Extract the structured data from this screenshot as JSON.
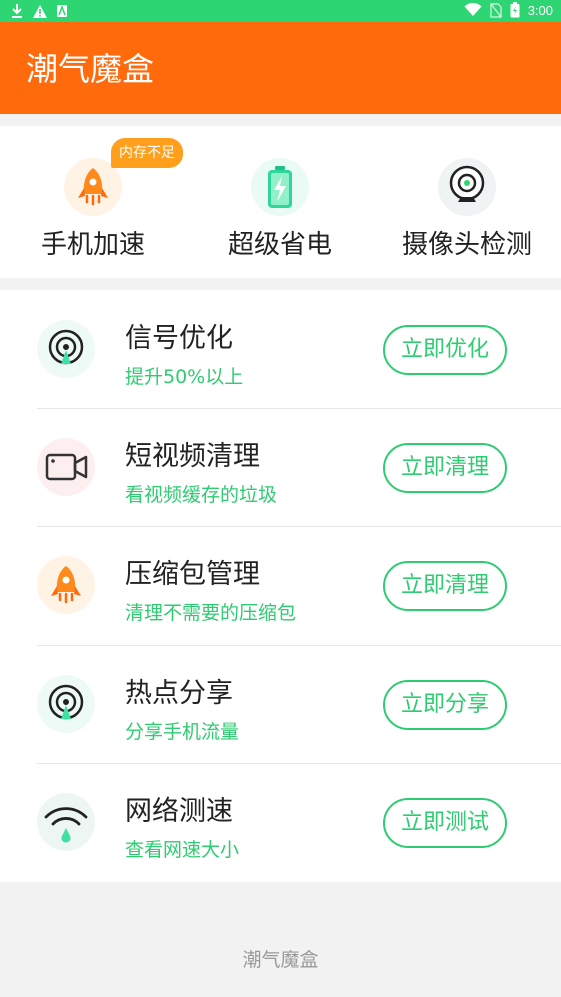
{
  "status_bar": {
    "time": "3:00"
  },
  "app_bar": {
    "title": "潮气魔盒"
  },
  "quick_actions": {
    "badge": "内存不足",
    "items": [
      {
        "label": "手机加速",
        "icon": "rocket-icon"
      },
      {
        "label": "超级省电",
        "icon": "battery-icon"
      },
      {
        "label": "摄像头检测",
        "icon": "camera-icon"
      }
    ]
  },
  "list": [
    {
      "title": "信号优化",
      "subtitle": "提升50%以上",
      "button": "立即优化",
      "icon": "signal-icon"
    },
    {
      "title": "短视频清理",
      "subtitle": "看视频缓存的垃圾",
      "button": "立即清理",
      "icon": "video-icon"
    },
    {
      "title": "压缩包管理",
      "subtitle": "清理不需要的压缩包",
      "button": "立即清理",
      "icon": "rocket-icon"
    },
    {
      "title": "热点分享",
      "subtitle": "分享手机流量",
      "button": "立即分享",
      "icon": "hotspot-icon"
    },
    {
      "title": "网络测速",
      "subtitle": "查看网速大小",
      "button": "立即测试",
      "icon": "wifi-icon"
    }
  ],
  "footer": {
    "text": "潮气魔盒"
  },
  "colors": {
    "status": "#2ed573",
    "header": "#ff6a0d",
    "accent": "#2ecc71",
    "badge": "#ff9f1c"
  }
}
